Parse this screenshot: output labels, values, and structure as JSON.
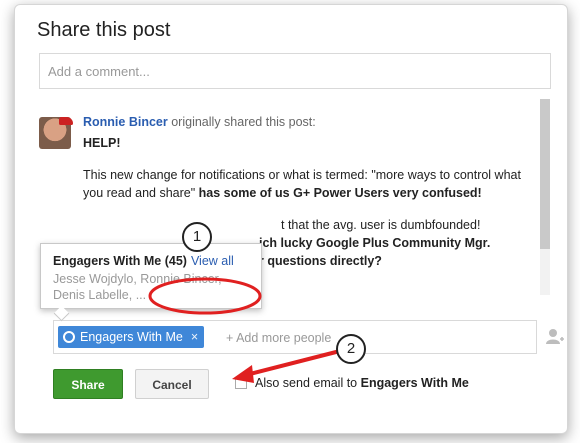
{
  "dialog": {
    "title": "Share this post",
    "comment_placeholder": "Add a comment..."
  },
  "post": {
    "author": "Ronnie Bincer",
    "author_suffix": "originally shared this post:",
    "heading": "HELP!",
    "para1_normal": "This new change for notifications or what is termed: \"more ways to control what you read and share\"",
    "para1_bold": " has some of us G+ Power Users very confused!",
    "para2_hidden": "...",
    "para2_visible": "t that the avg. user is dumbfounded!",
    "para3_bold": "ich lucky Google Plus Community Mgr.",
    "para4_bold": "r questions directly?"
  },
  "tooltip": {
    "circle_name": "Engagers With Me (45)",
    "view_all": "View all",
    "names_line1": "Jesse Wojdylo, Ronnie Bincer,",
    "names_line2": "Denis Labelle, ..."
  },
  "share": {
    "chip_label": "Engagers With Me",
    "chip_remove": "×",
    "add_more": "+ Add more people"
  },
  "actions": {
    "share_label": "Share",
    "cancel_label": "Cancel",
    "email_prefix": "Also send email to",
    "email_target": "Engagers With Me"
  },
  "annotations": {
    "badge1": "1",
    "badge2": "2",
    "color": "#e02020"
  }
}
